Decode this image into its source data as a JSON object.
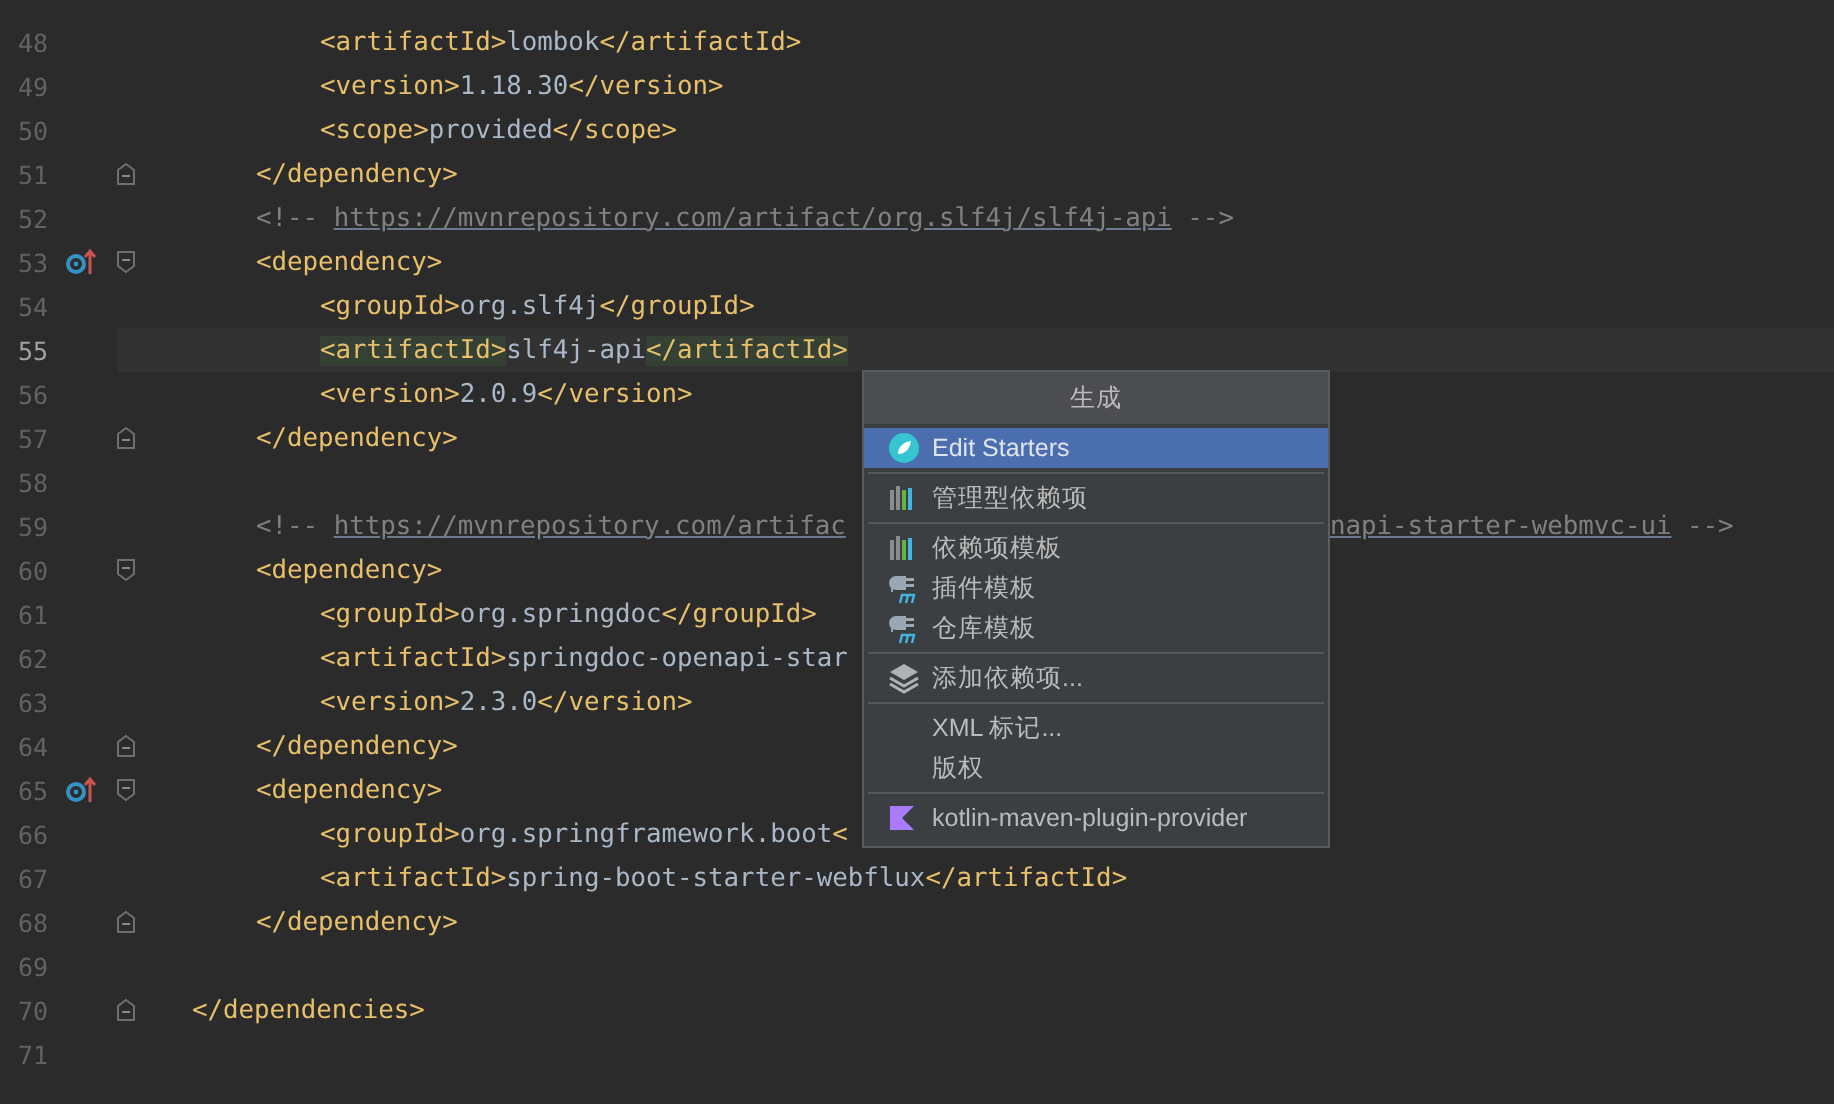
{
  "editor": {
    "lines": [
      {
        "kind": "line",
        "number": "48",
        "current": false,
        "code": [
          {
            "kind": "tag",
            "text": "<artifactId>"
          },
          {
            "kind": "text",
            "text": "lombok"
          },
          {
            "kind": "tag",
            "text": "</artifactId>"
          }
        ]
      },
      {
        "kind": "line",
        "number": "49",
        "current": false,
        "code": [
          {
            "kind": "tag",
            "text": "<version>"
          },
          {
            "kind": "text",
            "text": "1.18.30"
          },
          {
            "kind": "tag",
            "text": "</version>"
          }
        ]
      },
      {
        "kind": "line",
        "number": "50",
        "current": false,
        "code": [
          {
            "kind": "tag",
            "text": "<scope>"
          },
          {
            "kind": "text",
            "text": "provided"
          },
          {
            "kind": "tag",
            "text": "</scope>"
          }
        ]
      },
      {
        "kind": "block-end",
        "number": "51",
        "current": false,
        "code": [
          {
            "kind": "tag",
            "text": "</dependency>"
          }
        ]
      },
      {
        "kind": "line",
        "number": "52",
        "current": false,
        "code": [
          {
            "kind": "comment",
            "text": "<!-- "
          },
          {
            "kind": "link",
            "text": "https://mvnrepository.com/artifact/org.slf4j/slf4j-api"
          },
          {
            "kind": "comment",
            "text": " -->"
          }
        ]
      },
      {
        "kind": "block-start",
        "number": "53",
        "current": false,
        "marker": true,
        "code": [
          {
            "kind": "tag",
            "text": "<dependency>"
          }
        ]
      },
      {
        "kind": "line",
        "number": "54",
        "current": false,
        "code": [
          {
            "kind": "tag",
            "text": "<groupId>"
          },
          {
            "kind": "text",
            "text": "org.slf4j"
          },
          {
            "kind": "tag",
            "text": "</groupId>"
          }
        ]
      },
      {
        "kind": "line",
        "number": "55",
        "current": true,
        "code": [
          {
            "kind": "matched-tag",
            "text": "<artifactId>"
          },
          {
            "kind": "text",
            "text": "slf4j-api"
          },
          {
            "kind": "matched-tag",
            "text": "</artifactId>"
          }
        ]
      },
      {
        "kind": "line",
        "number": "56",
        "current": false,
        "code": [
          {
            "kind": "tag",
            "text": "<version>"
          },
          {
            "kind": "text",
            "text": "2.0.9"
          },
          {
            "kind": "tag",
            "text": "</version>"
          }
        ]
      },
      {
        "kind": "block-end",
        "number": "57",
        "current": false,
        "code": [
          {
            "kind": "tag",
            "text": "</dependency>"
          }
        ]
      },
      {
        "kind": "line",
        "number": "58",
        "current": false
      },
      {
        "kind": "line",
        "number": "59",
        "current": false,
        "code": [
          {
            "kind": "comment",
            "text": "<!-- "
          },
          {
            "kind": "link",
            "text": "https://mvnrepository.com/artifac"
          }
        ],
        "after_popup": [
          {
            "kind": "link",
            "text": "napi-starter-webmvc-ui"
          },
          {
            "kind": "comment",
            "text": " -->"
          }
        ]
      },
      {
        "kind": "block-start",
        "number": "60",
        "current": false,
        "code": [
          {
            "kind": "tag",
            "text": "<dependency>"
          }
        ]
      },
      {
        "kind": "line",
        "number": "61",
        "current": false,
        "code": [
          {
            "kind": "tag",
            "text": "<groupId>"
          },
          {
            "kind": "text",
            "text": "org.springdoc"
          },
          {
            "kind": "tag",
            "text": "</groupId>"
          }
        ]
      },
      {
        "kind": "line",
        "number": "62",
        "current": false,
        "code": [
          {
            "kind": "tag",
            "text": "<artifactId>"
          },
          {
            "kind": "text",
            "text": "springdoc-openapi-star"
          }
        ]
      },
      {
        "kind": "line",
        "number": "63",
        "current": false,
        "code": [
          {
            "kind": "tag",
            "text": "<version>"
          },
          {
            "kind": "text",
            "text": "2.3.0"
          },
          {
            "kind": "tag",
            "text": "</version>"
          }
        ]
      },
      {
        "kind": "block-end",
        "number": "64",
        "current": false,
        "code": [
          {
            "kind": "tag",
            "text": "</dependency>"
          }
        ]
      },
      {
        "kind": "block-start",
        "number": "65",
        "current": false,
        "marker": true,
        "code": [
          {
            "kind": "tag",
            "text": "<dependency>"
          }
        ]
      },
      {
        "kind": "line",
        "number": "66",
        "current": false,
        "code": [
          {
            "kind": "tag",
            "text": "<groupId>"
          },
          {
            "kind": "text",
            "text": "org.springframework.boot"
          },
          {
            "kind": "tag",
            "text": "<"
          }
        ]
      },
      {
        "kind": "line",
        "number": "67",
        "current": false,
        "code": [
          {
            "kind": "tag",
            "text": "<artifactId>"
          },
          {
            "kind": "text",
            "text": "spring-boot-starter-webflux"
          },
          {
            "kind": "tag",
            "text": "</artifactId>"
          }
        ]
      },
      {
        "kind": "block-end",
        "number": "68",
        "current": false,
        "code": [
          {
            "kind": "tag",
            "text": "</dependency>"
          }
        ]
      },
      {
        "kind": "line",
        "number": "69",
        "current": false
      },
      {
        "kind": "block-end",
        "number": "70",
        "current": false,
        "code": [
          {
            "kind": "tag",
            "text": "</dependencies>"
          }
        ]
      },
      {
        "kind": "line",
        "number": "71",
        "current": false
      }
    ]
  },
  "popup": {
    "title": "生成",
    "groups": [
      [
        {
          "kind": "starter",
          "label": "Edit Starters",
          "selected": true
        }
      ],
      [
        {
          "kind": "bars",
          "label": "管理型依赖项",
          "selected": false
        }
      ],
      [
        {
          "kind": "bars",
          "label": "依赖项模板",
          "selected": false
        },
        {
          "kind": "plugin",
          "label": "插件模板",
          "selected": false
        },
        {
          "kind": "plugin",
          "label": "仓库模板",
          "selected": false
        }
      ],
      [
        {
          "kind": "layers",
          "label": "添加依赖项...",
          "selected": false
        }
      ],
      [
        {
          "kind": "plain",
          "label": "XML 标记...",
          "selected": false
        },
        {
          "kind": "plain",
          "label": "版权",
          "selected": false
        }
      ],
      [
        {
          "kind": "kotlin",
          "label": "kotlin-maven-plugin-provider",
          "selected": false
        }
      ]
    ]
  }
}
